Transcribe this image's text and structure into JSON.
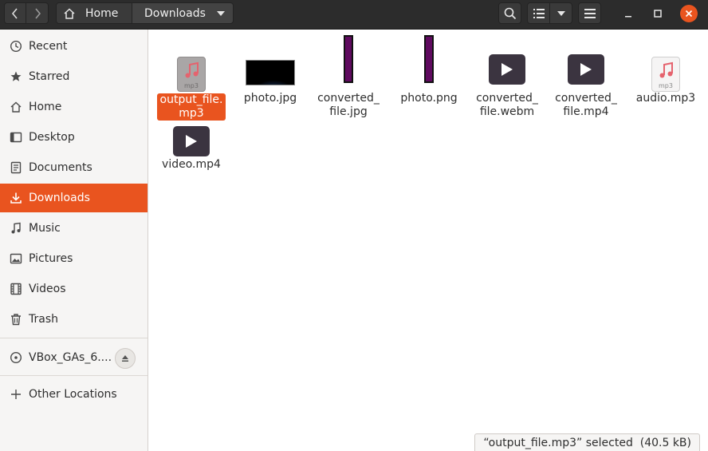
{
  "header": {
    "breadcrumb": [
      {
        "label": "Home",
        "icon": "home-icon"
      },
      {
        "label": "Downloads"
      }
    ]
  },
  "sidebar": {
    "places": [
      {
        "label": "Recent",
        "icon": "clock-icon"
      },
      {
        "label": "Starred",
        "icon": "star-icon"
      },
      {
        "label": "Home",
        "icon": "home-icon"
      },
      {
        "label": "Desktop",
        "icon": "desktop-icon"
      },
      {
        "label": "Documents",
        "icon": "document-icon"
      },
      {
        "label": "Downloads",
        "icon": "download-icon",
        "active": true
      },
      {
        "label": "Music",
        "icon": "music-note-icon"
      },
      {
        "label": "Pictures",
        "icon": "picture-icon"
      },
      {
        "label": "Videos",
        "icon": "film-icon"
      },
      {
        "label": "Trash",
        "icon": "trash-icon"
      }
    ],
    "devices": [
      {
        "label": "VBox_GAs_6....",
        "icon": "disc-icon"
      }
    ],
    "other": {
      "label": "Other Locations",
      "icon": "plus-icon"
    }
  },
  "files": [
    {
      "name": "output_file.\nmp3",
      "kind": "audio",
      "thumb_ext": "mp3",
      "selected": true
    },
    {
      "name": "photo.jpg",
      "kind": "photo"
    },
    {
      "name": "converted_\nfile.jpg",
      "kind": "strip"
    },
    {
      "name": "photo.png",
      "kind": "strip"
    },
    {
      "name": "converted_\nfile.webm",
      "kind": "video"
    },
    {
      "name": "converted_\nfile.mp4",
      "kind": "video"
    },
    {
      "name": "audio.mp3",
      "kind": "audio",
      "thumb_ext": "mp3"
    },
    {
      "name": "video.mp4",
      "kind": "video"
    }
  ],
  "status": {
    "text": "“output_file.mp3” selected  (40.5 kB)"
  },
  "colors": {
    "accent": "#e9541f",
    "headerbar": "#2c2c2c",
    "video_icon": "#3b3440",
    "music_note": "#e5636e",
    "strip_purple": "#5f0a5f"
  }
}
